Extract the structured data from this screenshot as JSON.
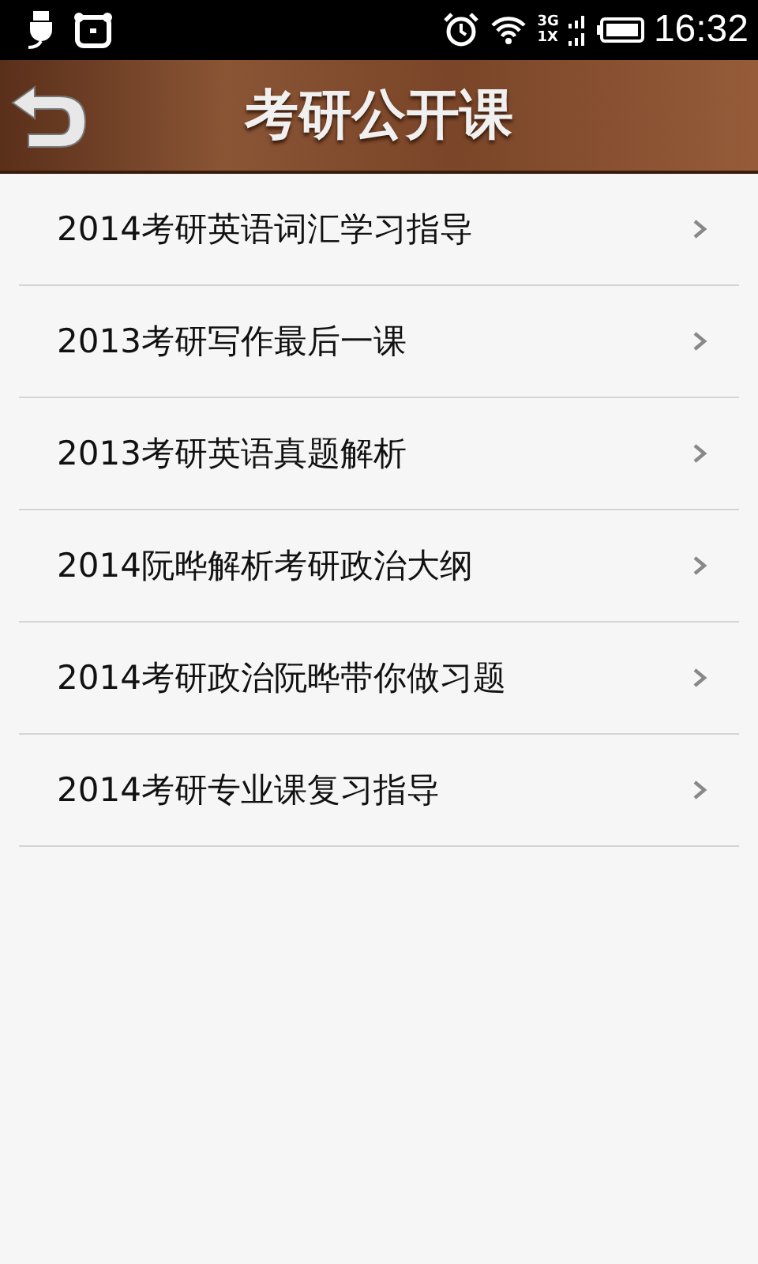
{
  "status_bar": {
    "network_top": "3G",
    "network_bottom": "1X",
    "time": "16:32"
  },
  "header": {
    "title": "考研公开课"
  },
  "items": [
    {
      "label": "2014考研英语词汇学习指导"
    },
    {
      "label": "2013考研写作最后一课"
    },
    {
      "label": "2013考研英语真题解析"
    },
    {
      "label": "2014阮晔解析考研政治大纲"
    },
    {
      "label": "2014考研政治阮晔带你做习题"
    },
    {
      "label": "2014考研专业课复习指导"
    }
  ]
}
